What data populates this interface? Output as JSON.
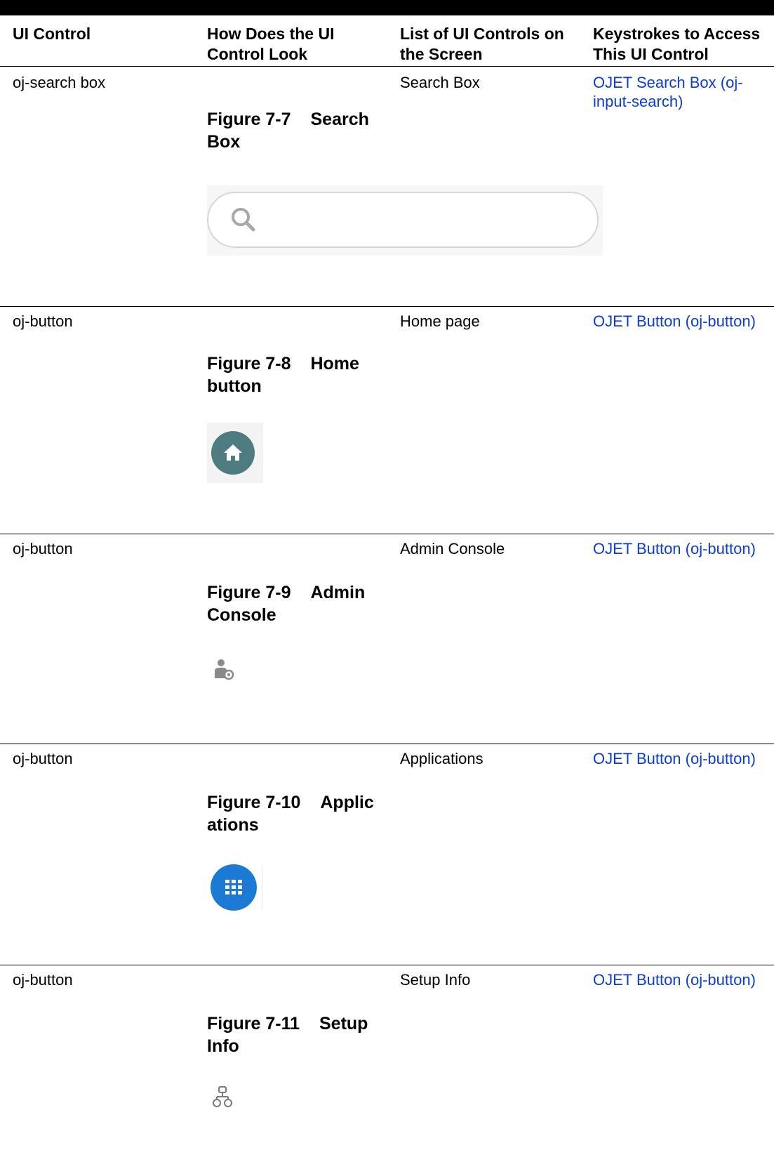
{
  "headers": {
    "ui_control": "UI Control",
    "look_line1": "How Does the UI",
    "look_line2": "Control Look",
    "list_line1": "List of UI Controls on",
    "list_line2": "the Screen",
    "keys_line1": "Keystrokes to Access",
    "keys_line2": "This UI Control"
  },
  "rows": [
    {
      "control": "oj-search box",
      "figure_number": "Figure 7-7",
      "figure_title_line1": "Search",
      "figure_title_line2": "Box",
      "screen_item": "Search Box",
      "link_line1": "OJET Search Box (oj-",
      "link_line2": "input-search)",
      "icon": "search-icon"
    },
    {
      "control": "oj-button",
      "figure_number": "Figure 7-8",
      "figure_title_line1": "Home",
      "figure_title_line2": "button",
      "screen_item": "Home page",
      "link": "OJET Button (oj-button)",
      "icon": "home-icon",
      "icon_color": "#4d7c80"
    },
    {
      "control": "oj-button",
      "figure_number": "Figure 7-9",
      "figure_title_line1": "Admin",
      "figure_title_line2": "Console",
      "screen_item": "Admin Console",
      "link": "OJET Button (oj-button)",
      "icon": "admin-user-gear-icon"
    },
    {
      "control": "oj-button",
      "figure_number": "Figure 7-10",
      "figure_title_line1": "Applic",
      "figure_title_line2": "ations",
      "screen_item": "Applications",
      "link": "OJET Button (oj-button)",
      "icon": "apps-grid-icon",
      "icon_color": "#1a7ad4"
    },
    {
      "control": "oj-button",
      "figure_number": "Figure 7-11",
      "figure_title_line1": "Setup",
      "figure_title_line2": "Info",
      "screen_item": "Setup Info",
      "link": "OJET Button (oj-button)",
      "icon": "setup-hierarchy-icon"
    }
  ],
  "colors": {
    "link": "#0b3cdb",
    "rule": "#000000"
  }
}
